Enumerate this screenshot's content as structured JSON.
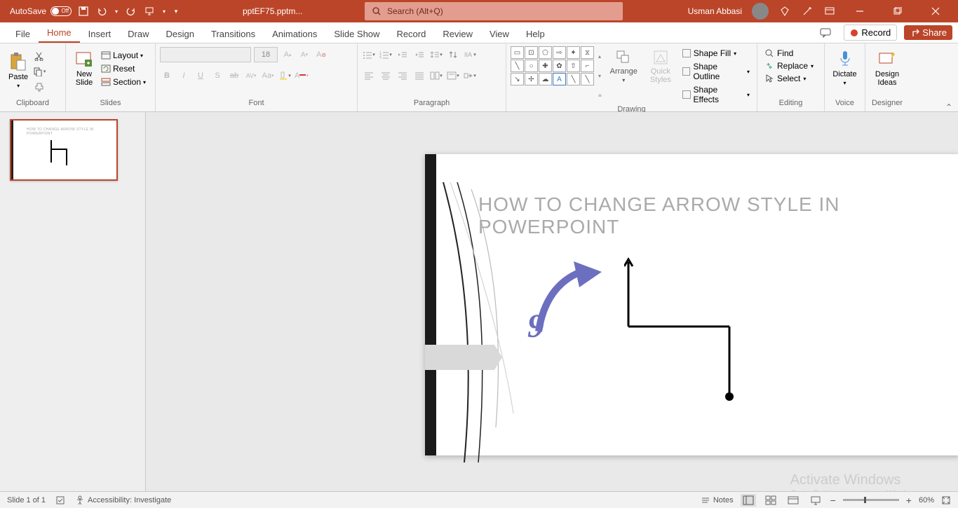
{
  "app": {
    "autosave_label": "AutoSave",
    "filename": "pptEF75.pptm...",
    "search_placeholder": "Search (Alt+Q)",
    "user": "Usman Abbasi"
  },
  "tabs": [
    "File",
    "Home",
    "Insert",
    "Draw",
    "Design",
    "Transitions",
    "Animations",
    "Slide Show",
    "Record",
    "Review",
    "View",
    "Help"
  ],
  "tab_extras": {
    "comments": "",
    "record": "Record",
    "share": "Share"
  },
  "ribbon": {
    "clipboard": {
      "paste": "Paste",
      "label": "Clipboard"
    },
    "slides": {
      "new_slide": "New\nSlide",
      "layout": "Layout",
      "reset": "Reset",
      "section": "Section",
      "label": "Slides"
    },
    "font": {
      "name": "",
      "size": "18",
      "label": "Font"
    },
    "paragraph": {
      "label": "Paragraph"
    },
    "drawing": {
      "arrange": "Arrange",
      "quick": "Quick\nStyles",
      "fill": "Shape Fill",
      "outline": "Shape Outline",
      "effects": "Shape Effects",
      "label": "Drawing"
    },
    "editing": {
      "find": "Find",
      "replace": "Replace",
      "select": "Select",
      "label": "Editing"
    },
    "voice": {
      "dictate": "Dictate",
      "label": "Voice"
    },
    "designer": {
      "ideas": "Design\nIdeas",
      "label": "Designer"
    }
  },
  "slide": {
    "title": "HOW TO CHANGE ARROW STYLE IN POWERPOINT",
    "number": "9"
  },
  "watermark": {
    "title": "Activate Windows",
    "sub": "Go to Settings to activate Windows."
  },
  "status": {
    "slide": "Slide 1 of 1",
    "accessibility": "Accessibility: Investigate",
    "notes": "Notes",
    "zoom": "60%"
  }
}
